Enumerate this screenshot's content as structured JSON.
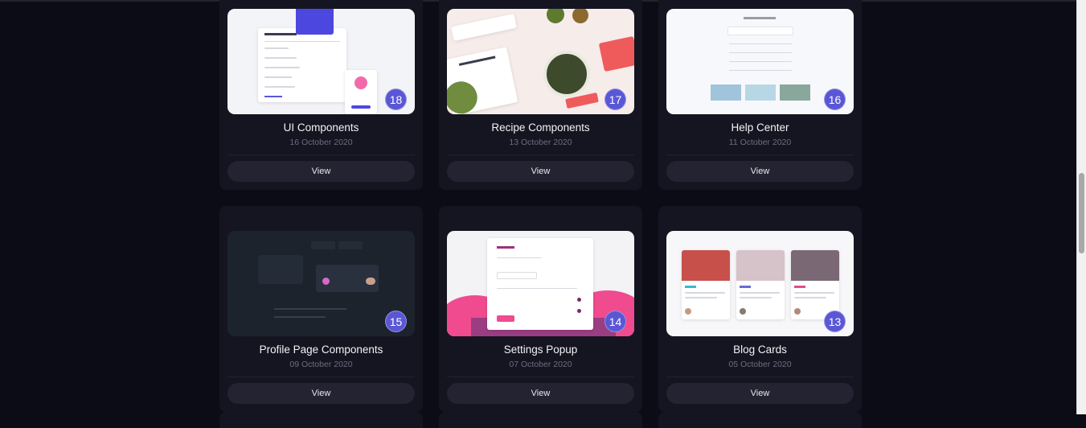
{
  "cards": [
    {
      "title": "UI Components",
      "date": "16 October 2020",
      "count": "18",
      "view": "View"
    },
    {
      "title": "Recipe Components",
      "date": "13 October 2020",
      "count": "17",
      "view": "View"
    },
    {
      "title": "Help Center",
      "date": "11 October 2020",
      "count": "16",
      "view": "View"
    },
    {
      "title": "Profile Page Components",
      "date": "09 October 2020",
      "count": "15",
      "view": "View"
    },
    {
      "title": "Settings Popup",
      "date": "07 October 2020",
      "count": "14",
      "view": "View"
    },
    {
      "title": "Blog Cards",
      "date": "05 October 2020",
      "count": "13",
      "view": "View"
    }
  ],
  "colors": {
    "page_bg": "#0c0c17",
    "card_bg": "#151521",
    "badge": "#5a57d6",
    "button_bg": "#232331"
  }
}
